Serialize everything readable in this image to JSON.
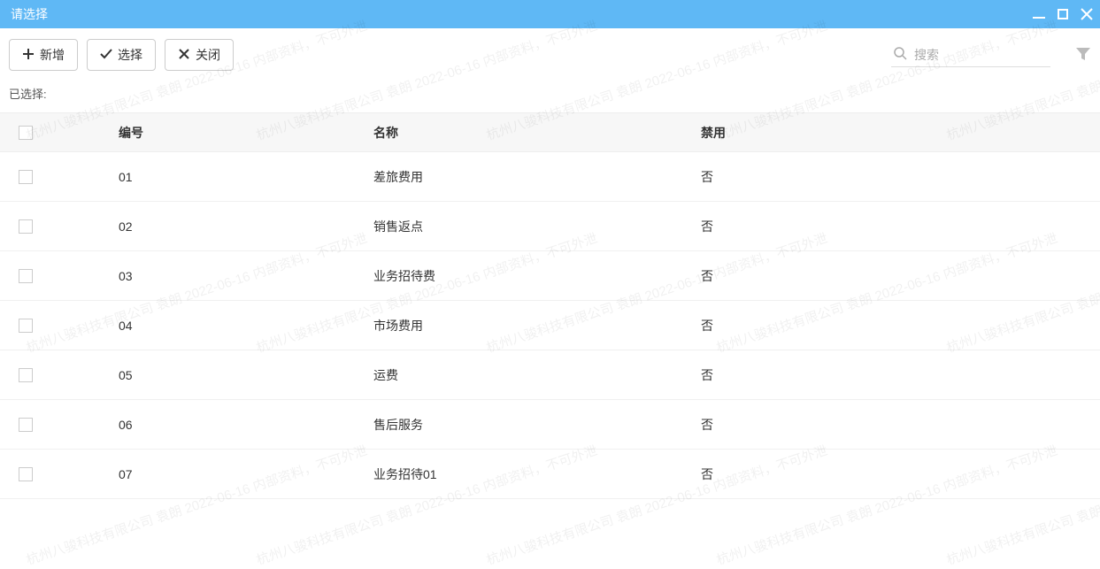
{
  "window": {
    "title": "请选择"
  },
  "toolbar": {
    "add_label": "新增",
    "select_label": "选择",
    "close_label": "关闭"
  },
  "search": {
    "placeholder": "搜索"
  },
  "selected_label": "已选择:",
  "table": {
    "headers": {
      "code": "编号",
      "name": "名称",
      "disabled": "禁用"
    },
    "rows": [
      {
        "code": "01",
        "name": "差旅费用",
        "disabled": "否"
      },
      {
        "code": "02",
        "name": "销售返点",
        "disabled": "否"
      },
      {
        "code": "03",
        "name": "业务招待费",
        "disabled": "否"
      },
      {
        "code": "04",
        "name": "市场费用",
        "disabled": "否"
      },
      {
        "code": "05",
        "name": "运费",
        "disabled": "否"
      },
      {
        "code": "06",
        "name": "售后服务",
        "disabled": "否"
      },
      {
        "code": "07",
        "name": "业务招待01",
        "disabled": "否"
      }
    ]
  },
  "watermark_text": "杭州八骏科技有限公司 袁朗 2022-06-16 内部资料，不可外泄"
}
